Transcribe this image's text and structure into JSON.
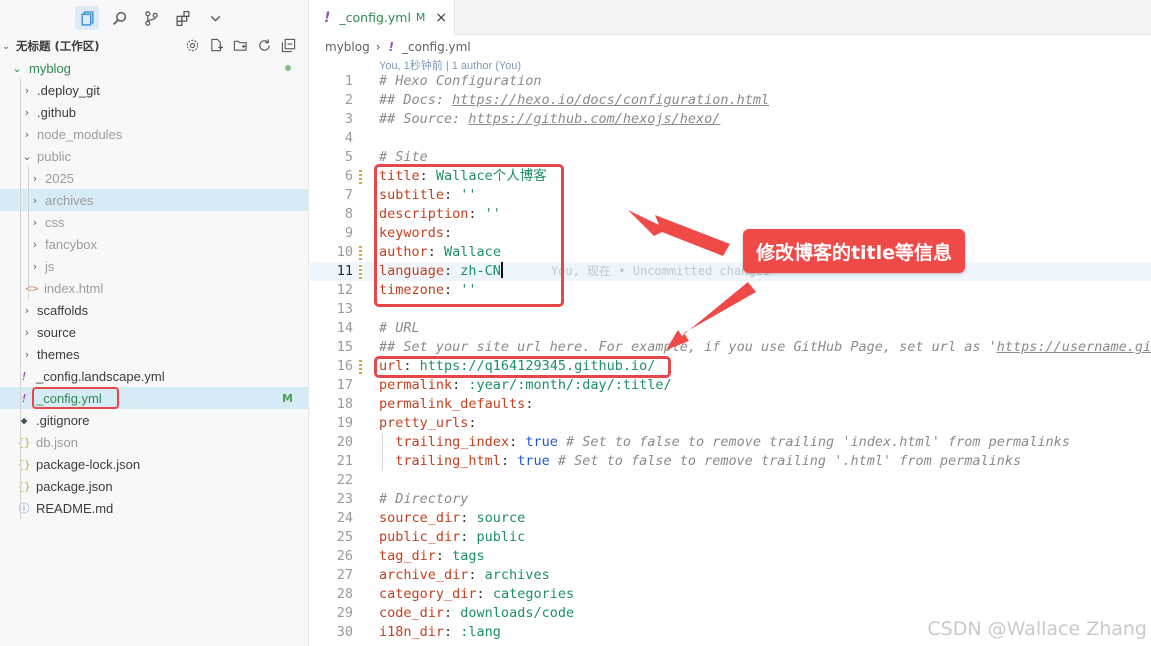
{
  "activity_bar": {
    "items": [
      {
        "name": "explorer-icon",
        "active": true
      },
      {
        "name": "search-icon"
      },
      {
        "name": "source-control-icon"
      },
      {
        "name": "extensions-icon"
      },
      {
        "name": "chevron-down-icon"
      }
    ]
  },
  "explorer": {
    "workspace_title": "无标题 (工作区)",
    "actions": [
      "settings-icon",
      "new-file-icon",
      "new-folder-icon",
      "refresh-icon",
      "collapse-all-icon"
    ],
    "root": "myblog",
    "items": [
      {
        "label": ".deploy_git",
        "kind": "folder",
        "depth": 1
      },
      {
        "label": ".github",
        "kind": "folder",
        "depth": 1
      },
      {
        "label": "node_modules",
        "kind": "folder",
        "depth": 1,
        "dim": true
      },
      {
        "label": "public",
        "kind": "folder-open",
        "depth": 1,
        "dim": true
      },
      {
        "label": "2025",
        "kind": "folder",
        "depth": 2,
        "dim": true
      },
      {
        "label": "archives",
        "kind": "folder",
        "depth": 2,
        "dim": true
      },
      {
        "label": "css",
        "kind": "folder",
        "depth": 2,
        "dim": true
      },
      {
        "label": "fancybox",
        "kind": "folder",
        "depth": 2,
        "dim": true
      },
      {
        "label": "js",
        "kind": "folder",
        "depth": 2,
        "dim": true
      },
      {
        "label": "index.html",
        "kind": "html",
        "depth": 2,
        "dim": true
      },
      {
        "label": "scaffolds",
        "kind": "folder",
        "depth": 1
      },
      {
        "label": "source",
        "kind": "folder",
        "depth": 1
      },
      {
        "label": "themes",
        "kind": "folder",
        "depth": 1
      },
      {
        "label": "_config.landscape.yml",
        "kind": "yml",
        "depth": 1
      },
      {
        "label": "_config.yml",
        "kind": "yml",
        "depth": 1,
        "modified": "M",
        "selected": true
      },
      {
        "label": ".gitignore",
        "kind": "git",
        "depth": 1
      },
      {
        "label": "db.json",
        "kind": "json",
        "depth": 1,
        "dim": true
      },
      {
        "label": "package-lock.json",
        "kind": "json",
        "depth": 1
      },
      {
        "label": "package.json",
        "kind": "json",
        "depth": 1
      },
      {
        "label": "README.md",
        "kind": "md",
        "depth": 1
      }
    ]
  },
  "editor": {
    "tab": {
      "name": "_config.yml",
      "status": "M",
      "close": "×"
    },
    "breadcrumb": {
      "folder": "myblog",
      "file": "_config.yml"
    },
    "blame": "You, 1秒钟前 | 1 author (You)",
    "inline_blame": "You, 现在 • Uncommitted changes",
    "annotation": "修改博客的title等信息",
    "watermark": "CSDN @Wallace Zhang",
    "lines": [
      {
        "n": "1",
        "seg": [
          [
            "c",
            "# Hexo Configuration"
          ]
        ]
      },
      {
        "n": "2",
        "seg": [
          [
            "c",
            "## Docs: "
          ],
          [
            "cu",
            "https://hexo.io/docs/configuration.html"
          ]
        ]
      },
      {
        "n": "3",
        "seg": [
          [
            "c",
            "## Source: "
          ],
          [
            "cu",
            "https://github.com/hexojs/hexo/"
          ]
        ]
      },
      {
        "n": "4",
        "seg": []
      },
      {
        "n": "5",
        "seg": [
          [
            "c",
            "# Site"
          ]
        ]
      },
      {
        "n": "6",
        "seg": [
          [
            "k",
            "title"
          ],
          [
            "p",
            ": "
          ],
          [
            "v",
            "Wallace个人博客"
          ]
        ],
        "mark": true
      },
      {
        "n": "7",
        "seg": [
          [
            "k",
            "subtitle"
          ],
          [
            "p",
            ": "
          ],
          [
            "v",
            "''"
          ]
        ]
      },
      {
        "n": "8",
        "seg": [
          [
            "k",
            "description"
          ],
          [
            "p",
            ": "
          ],
          [
            "v",
            "''"
          ]
        ]
      },
      {
        "n": "9",
        "seg": [
          [
            "k",
            "keywords"
          ],
          [
            "p",
            ":"
          ]
        ]
      },
      {
        "n": "10",
        "seg": [
          [
            "k",
            "author"
          ],
          [
            "p",
            ": "
          ],
          [
            "v",
            "Wallace"
          ]
        ],
        "mark": true
      },
      {
        "n": "11",
        "seg": [
          [
            "k",
            "language"
          ],
          [
            "p",
            ": "
          ],
          [
            "v",
            "zh-CN"
          ]
        ],
        "mark": true,
        "current": true
      },
      {
        "n": "12",
        "seg": [
          [
            "k",
            "timezone"
          ],
          [
            "p",
            ": "
          ],
          [
            "v",
            "''"
          ]
        ]
      },
      {
        "n": "13",
        "seg": []
      },
      {
        "n": "14",
        "seg": [
          [
            "c",
            "# URL"
          ]
        ]
      },
      {
        "n": "15",
        "seg": [
          [
            "c",
            "## Set your site url here. For example, if you use GitHub Page, set url as '"
          ],
          [
            "cu",
            "https://username.github.io/project"
          ]
        ]
      },
      {
        "n": "16",
        "seg": [
          [
            "k",
            "url"
          ],
          [
            "p",
            ": "
          ],
          [
            "v",
            "https://q164129345.github.io/"
          ]
        ],
        "mark": true
      },
      {
        "n": "17",
        "seg": [
          [
            "k",
            "permalink"
          ],
          [
            "p",
            ": "
          ],
          [
            "v",
            ":year/:month/:day/:title/"
          ]
        ]
      },
      {
        "n": "18",
        "seg": [
          [
            "k",
            "permalink_defaults"
          ],
          [
            "p",
            ":"
          ]
        ]
      },
      {
        "n": "19",
        "seg": [
          [
            "k",
            "pretty_urls"
          ],
          [
            "p",
            ":"
          ]
        ]
      },
      {
        "n": "20",
        "seg": [
          [
            "p",
            "  "
          ],
          [
            "k",
            "trailing_index"
          ],
          [
            "p",
            ": "
          ],
          [
            "b",
            "true"
          ],
          [
            "c",
            " # Set to false to remove trailing 'index.html' from permalinks"
          ]
        ],
        "guide": true
      },
      {
        "n": "21",
        "seg": [
          [
            "p",
            "  "
          ],
          [
            "k",
            "trailing_html"
          ],
          [
            "p",
            ": "
          ],
          [
            "b",
            "true"
          ],
          [
            "c",
            " # Set to false to remove trailing '.html' from permalinks"
          ]
        ],
        "guide": true
      },
      {
        "n": "22",
        "seg": []
      },
      {
        "n": "23",
        "seg": [
          [
            "c",
            "# Directory"
          ]
        ]
      },
      {
        "n": "24",
        "seg": [
          [
            "k",
            "source_dir"
          ],
          [
            "p",
            ": "
          ],
          [
            "v",
            "source"
          ]
        ]
      },
      {
        "n": "25",
        "seg": [
          [
            "k",
            "public_dir"
          ],
          [
            "p",
            ": "
          ],
          [
            "v",
            "public"
          ]
        ]
      },
      {
        "n": "26",
        "seg": [
          [
            "k",
            "tag_dir"
          ],
          [
            "p",
            ": "
          ],
          [
            "v",
            "tags"
          ]
        ]
      },
      {
        "n": "27",
        "seg": [
          [
            "k",
            "archive_dir"
          ],
          [
            "p",
            ": "
          ],
          [
            "v",
            "archives"
          ]
        ]
      },
      {
        "n": "28",
        "seg": [
          [
            "k",
            "category_dir"
          ],
          [
            "p",
            ": "
          ],
          [
            "v",
            "categories"
          ]
        ]
      },
      {
        "n": "29",
        "seg": [
          [
            "k",
            "code_dir"
          ],
          [
            "p",
            ": "
          ],
          [
            "v",
            "downloads/code"
          ]
        ]
      },
      {
        "n": "30",
        "seg": [
          [
            "k",
            "i18n_dir"
          ],
          [
            "p",
            ": "
          ],
          [
            "v",
            ":lang"
          ]
        ]
      }
    ]
  },
  "colors": {
    "accent_red": "#ef4a47",
    "git_modified": "#4f9e53",
    "key": "#c5401f",
    "string": "#1c8e6b"
  }
}
